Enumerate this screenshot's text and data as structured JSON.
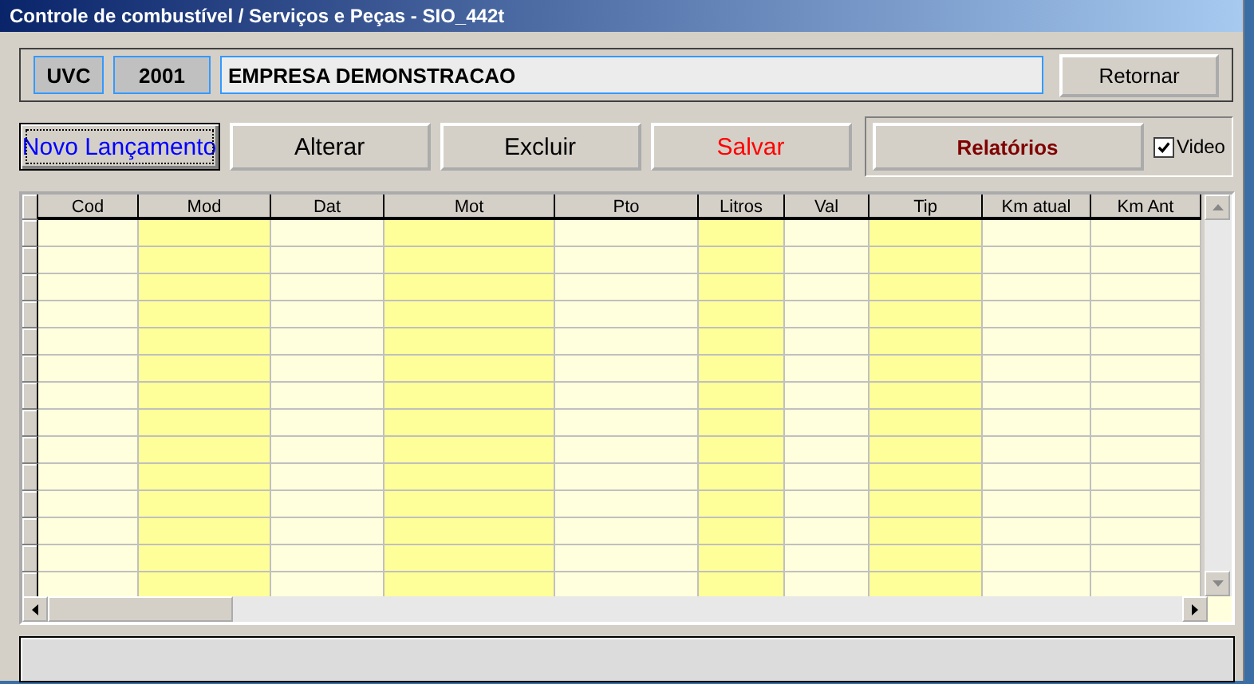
{
  "window": {
    "title": "Controle de combustível / Serviços e Peças - SIO_442t"
  },
  "header": {
    "code": "UVC",
    "year": "2001",
    "company": "EMPRESA DEMONSTRACAO",
    "return_button": "Retornar"
  },
  "actions": [
    {
      "label": "Novo Lançamento",
      "color": "#0000ff",
      "selected": true
    },
    {
      "label": "Alterar",
      "color": "#000000",
      "selected": false
    },
    {
      "label": "Excluir",
      "color": "#000000",
      "selected": false
    },
    {
      "label": "Salvar",
      "color": "#ff0000",
      "selected": false
    }
  ],
  "reports_button": "Relatórios",
  "video": {
    "label": "Video",
    "checked": true
  },
  "table": {
    "columns": [
      {
        "label": "Cod",
        "color": "#ffffdd"
      },
      {
        "label": "Mod",
        "color": "#ffff99"
      },
      {
        "label": "Dat",
        "color": "#ffffdd"
      },
      {
        "label": "Mot",
        "color": "#ffff99"
      },
      {
        "label": "Pto",
        "color": "#ffffdd"
      },
      {
        "label": "Litros",
        "color": "#ffff99"
      },
      {
        "label": "Val",
        "color": "#ffffdd"
      },
      {
        "label": "Tip",
        "color": "#ffff99"
      },
      {
        "label": "Km atual",
        "color": "#ffffdd"
      },
      {
        "label": "Km Ant",
        "color": "#ffffdd"
      }
    ]
  }
}
